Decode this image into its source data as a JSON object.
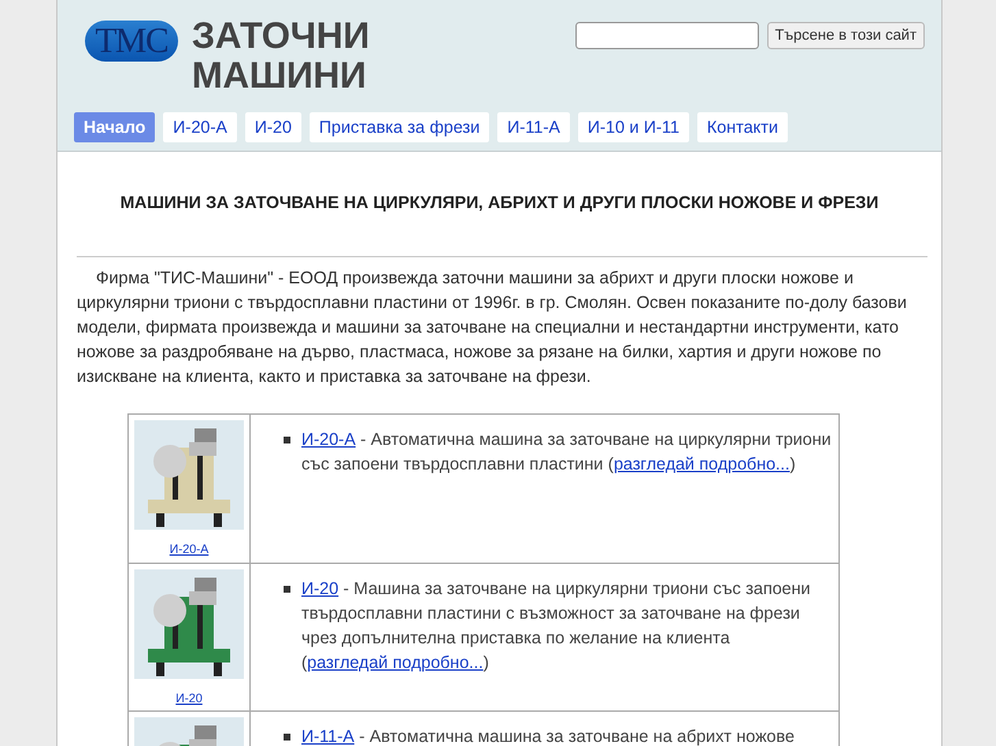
{
  "header": {
    "logo": "ТМС",
    "title_lines": [
      "ЗАТОЧНИ",
      "МАШИНИ"
    ],
    "search": {
      "button": "Търсене в този сайт"
    }
  },
  "nav": [
    {
      "label": "Начало",
      "selected": true
    },
    {
      "label": "И-20-А",
      "selected": false
    },
    {
      "label": "И-20",
      "selected": false
    },
    {
      "label": "Приставка за фрези",
      "selected": false
    },
    {
      "label": "И-11-А",
      "selected": false
    },
    {
      "label": "И-10 и И-11",
      "selected": false
    },
    {
      "label": "Контакти",
      "selected": false
    }
  ],
  "heading": "МАШИНИ ЗА ЗАТОЧВАНЕ НА ЦИРКУЛЯРИ, АБРИХТ И ДРУГИ ПЛОСКИ НОЖОВЕ И ФРЕЗИ",
  "intro": "Фирма \"ТИС-Машини\" - ЕООД произвежда заточни машини за абрихт и други плоски ножове и циркулярни триони с твърдосплавни пластини от 1996г. в гр. Смолян. Освен показаните по-долу базови модели, фирмата произвежда и машини за заточване на специални и нестандартни инструменти, като ножове за раздробяване на дърво, пластмаса, ножове за рязане на билки, хартия и други ножове по изискване на клиента, както и приставка за заточване на фрези.",
  "products": [
    {
      "caption": "И-20-А",
      "name": "И-20-А",
      "text": " - Автоматична машина за заточване на циркулярни триони със запоени твърдосплавни пластини (",
      "more": "разгледай подробно...",
      "after": ")"
    },
    {
      "caption": "И-20",
      "name": "И-20",
      "text": " - Машина за заточване на циркулярни триони със запоени твърдосплавни пластини с възможност за заточване на фрези чрез допълнителна приставка по желание на клиента (",
      "more": "разгледай подробно...",
      "after": ")"
    },
    {
      "name": "И-11-А",
      "text": " - Автоматична машина за заточване на абрихт ножове"
    }
  ]
}
